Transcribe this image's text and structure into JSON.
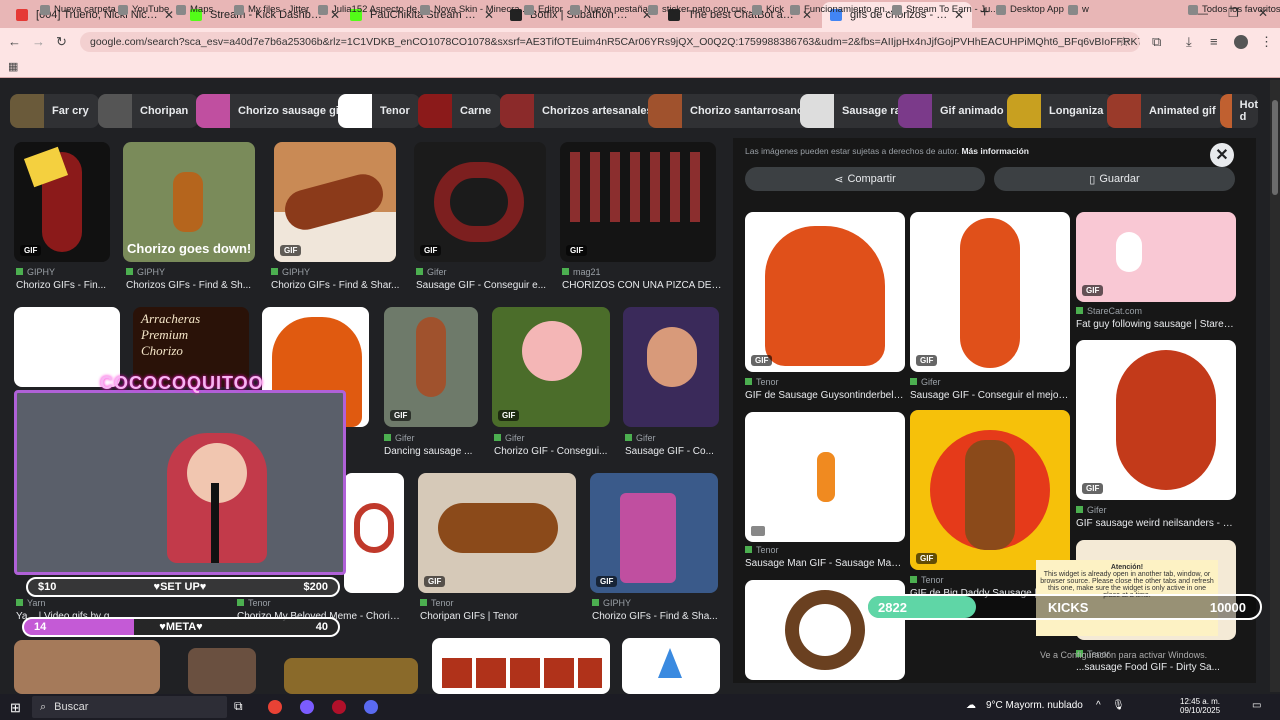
{
  "tabs": [
    {
      "title": "[604] Trueno, Nicki Nicole, Ba",
      "color": "#e53935"
    },
    {
      "title": "Stream - Kick Dashboard",
      "color": "#53fc18"
    },
    {
      "title": "PauChikita Stream - Watch Live",
      "color": "#53fc18"
    },
    {
      "title": "Botfix | Subathon Widget",
      "color": "#222222"
    },
    {
      "title": "The best ChatBot and Widgets",
      "color": "#222222"
    },
    {
      "title": "gifs de chorizos - Buscar con G",
      "color": "#4285f4"
    }
  ],
  "url": "google.com/search?sca_esv=a40d7e7b6a25306b&rlz=1C1VDKB_enCO1078CO1078&sxsrf=AE3TifOTEuim4nR5CAr06YRs9jQX_O0Q2Q:1759988386763&udm=2&fbs=AIIjpHx4nJjfGojPVHhEACUHPiMQht6_BFq6vBIoFFRK7qchKG1cRgcE0P7z3SNiz",
  "bookmarks": [
    "Nueva carpeta",
    "YouTube",
    "Maps",
    "My files - Jitter",
    "Julia152 Aspecto de...",
    "Nova Skin - Minecra...",
    "Editor",
    "Nueva pestaña",
    "sticker pato con cuc...",
    "Kick",
    "Funcionamiento en...",
    "Stream To Earn - Ju...",
    "Desktop App",
    "w",
    "Todos los favoritos"
  ],
  "chips": [
    "Far cry",
    "Choripan",
    "Chorizo sausage gif",
    "Tenor",
    "Carne",
    "Chorizos artesanales",
    "Chorizo santarrosano",
    "Sausage race gif",
    "Gif animado",
    "Longaniza",
    "Animated gif",
    "Hot d"
  ],
  "results_row1": [
    {
      "source": "GIPHY",
      "title": "Chorizo GIFs - Fin..."
    },
    {
      "source": "GIPHY",
      "title": "Chorizos GIFs - Find & Sh..."
    },
    {
      "source": "GIPHY",
      "title": "Chorizo GIFs - Find & Shar..."
    },
    {
      "source": "Gifer",
      "title": "Sausage GIF - Conseguir e..."
    },
    {
      "source": "mag21",
      "title": "CHORIZOS CON UNA PIZCA DE ..."
    }
  ],
  "results_row2": [
    {
      "source": "Gifer",
      "title": "Dancing sausage ..."
    },
    {
      "source": "Gifer",
      "title": "Chorizo GIF - Consegui..."
    },
    {
      "source": "Gifer",
      "title": "Sausage GIF - Co..."
    }
  ],
  "results_row3": [
    {
      "source": "Yarn",
      "title": "Ya... | Video gifs by q..."
    },
    {
      "source": "Tenor",
      "title": "Chorizo My Beloved Meme - Choriz..."
    },
    {
      "source": "Tenor",
      "title": "Choripan GIFs | Tenor"
    },
    {
      "source": "GIPHY",
      "title": "Chorizo GIFs - Find & Sha..."
    }
  ],
  "panel": {
    "copyright": "Las imágenes pueden estar sujetas a derechos de autor.",
    "more_info": "Más información",
    "share": "Compartir",
    "save": "Guardar",
    "items": [
      {
        "source": "Tenor",
        "title": "GIF de Sausage Guysontinderbelik..."
      },
      {
        "source": "Gifer",
        "title": "Sausage GIF - Conseguir el mejor ..."
      },
      {
        "source": "StareCat.com",
        "title": "Fat guy following sausage | StareC..."
      },
      {
        "source": "Gifer",
        "title": "GIF sausage weird neilsanders - a..."
      },
      {
        "source": "Tenor",
        "title": "Sausage Man GIF - Sausage Man ..."
      },
      {
        "source": "Tenor",
        "title": "GIF de Big Daddy Sausage | ..."
      },
      {
        "source": "Tenor",
        "title": "...sausage Food GIF - Dirty Sa..."
      }
    ]
  },
  "overlay": {
    "title": "COCOCOQUITOO",
    "bar1_left": "$10",
    "bar1_mid": "♥SET UP♥",
    "bar1_right": "$200",
    "bar2_left": "14",
    "bar2_mid": "♥META♥",
    "bar2_right": "40",
    "kicks_left": "2822",
    "kicks_mid": "KICKS",
    "kicks_right": "10000",
    "warn_title": "Atención!",
    "warn_text": "This widget is already open in another tab, window, or browser source. Please close the other tabs and refresh this one, make sure the widget is only active in one place at a time.",
    "activate": "Ve a Configuración para activar Windows."
  },
  "taskbar": {
    "search": "Buscar",
    "weather": "9°C  Mayorm. nublado",
    "time": "12:45 a. m.",
    "date": "09/10/2025"
  }
}
